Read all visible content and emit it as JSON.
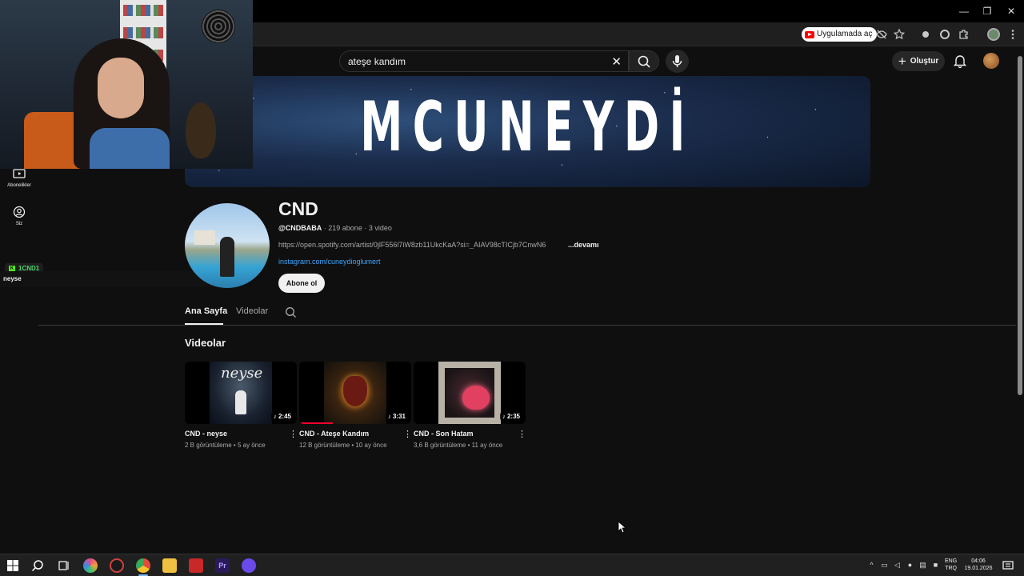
{
  "browser": {
    "open_in_app_label": "Uygulamada aç",
    "window_controls": [
      "—",
      "❐",
      "✕"
    ]
  },
  "header": {
    "search_value": "ateşe kandım",
    "create_label": "Oluştur"
  },
  "banner": {
    "title": "MCUNEYDİ"
  },
  "sidebar": {
    "items": [
      {
        "label": "Abonelikler",
        "icon": "subscriptions-icon"
      },
      {
        "label": "Siz",
        "icon": "you-icon"
      }
    ]
  },
  "overlay": {
    "kick_badge_label": "1CND1",
    "now_playing": "neyse"
  },
  "channel": {
    "name": "CND",
    "handle": "@CNDBABA",
    "stats": " · 219 abone · 3 video",
    "description": "https://open.spotify.com/artist/0jlF556l7iW8zb11UkcKaA?si=_AIAV98cTICjb7CnwN6",
    "more_label": "...devamı",
    "link": "instagram.com/cuneydioglumert",
    "subscribe_label": "Abone ol"
  },
  "tabs": [
    {
      "label": "Ana Sayfa",
      "active": true
    },
    {
      "label": "Videolar",
      "active": false
    }
  ],
  "section": {
    "title": "Videolar"
  },
  "videos": [
    {
      "title": "CND - neyse",
      "meta": "2 B görüntüleme • 5 ay önce",
      "duration": "2:45",
      "thumb_text": "neyse",
      "watched_fraction": 0
    },
    {
      "title": "CND - Ateşe Kandım",
      "meta": "12 B görüntüleme • 10 ay önce",
      "duration": "3:31",
      "watched_fraction": 0.3
    },
    {
      "title": "CND - Son Hatam",
      "meta": "3,6 B görüntüleme • 11 ay önce",
      "duration": "2:35",
      "watched_fraction": 0
    }
  ],
  "taskbar": {
    "lang_top": "ENG",
    "lang_bottom": "TRQ",
    "time": "04:06",
    "date": "19.01.2026"
  },
  "colors": {
    "background": "#0f0f0f",
    "accent_red": "#ff0033",
    "link_blue": "#3ea6ff",
    "kick_green": "#53fc18"
  }
}
